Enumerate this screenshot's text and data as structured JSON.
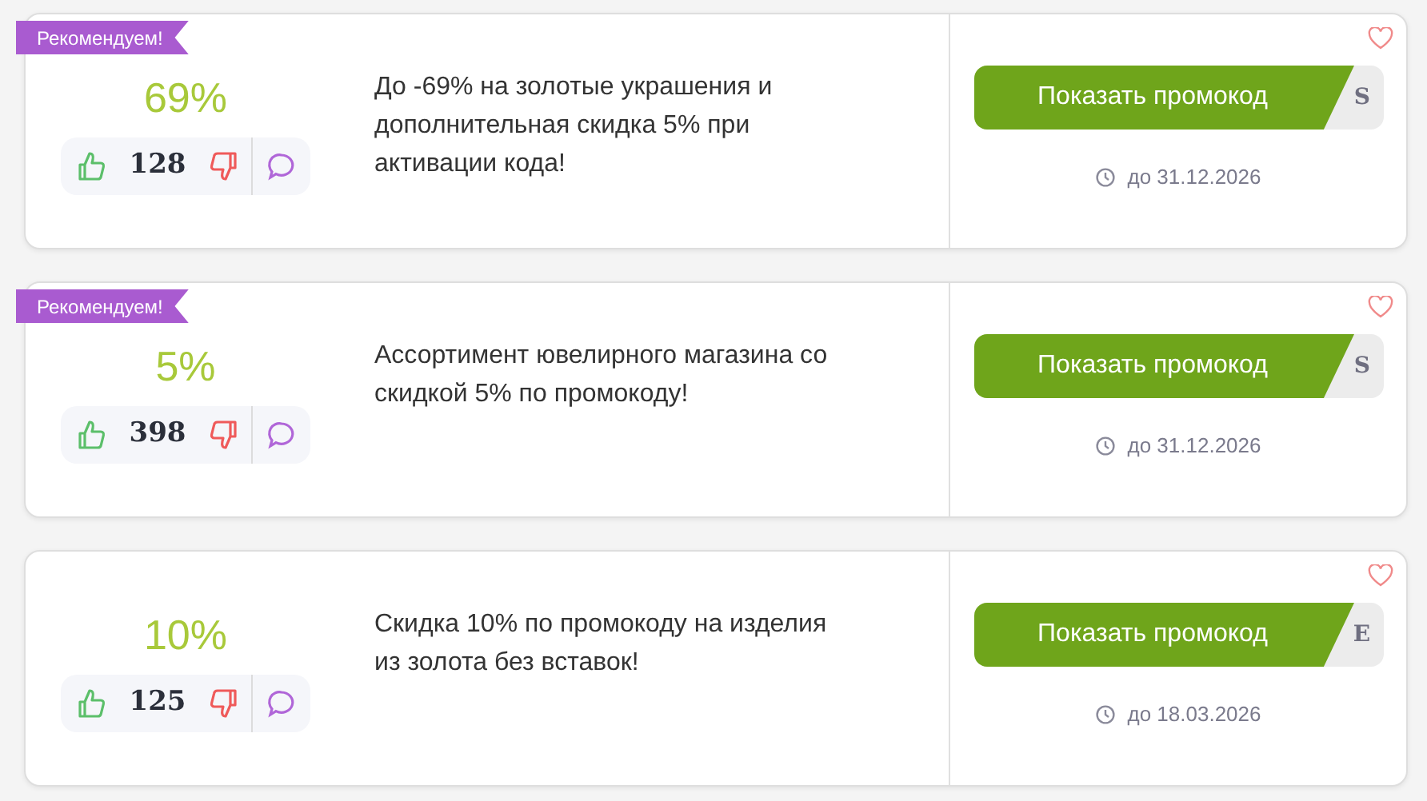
{
  "offers": [
    {
      "recommended": true,
      "badge": "Рекомендуем!",
      "discount": "69%",
      "likes": "128",
      "description": "До -69% на золотые украшения и дополнительная скидка 5% при активации кода!",
      "button": "Показать промокод",
      "code_peek": "S",
      "expires": "до 31.12.2026"
    },
    {
      "recommended": true,
      "badge": "Рекомендуем!",
      "discount": "5%",
      "likes": "398",
      "description": "Ассортимент ювелирного магазина со скидкой 5% по промокоду!",
      "button": "Показать промокод",
      "code_peek": "S",
      "expires": "до 31.12.2026"
    },
    {
      "recommended": false,
      "discount": "10%",
      "likes": "125",
      "description": "Скидка 10% по промокоду на изделия из золота без вставок!",
      "button": "Показать промокод",
      "code_peek": "E",
      "expires": "до 18.03.2026"
    }
  ]
}
